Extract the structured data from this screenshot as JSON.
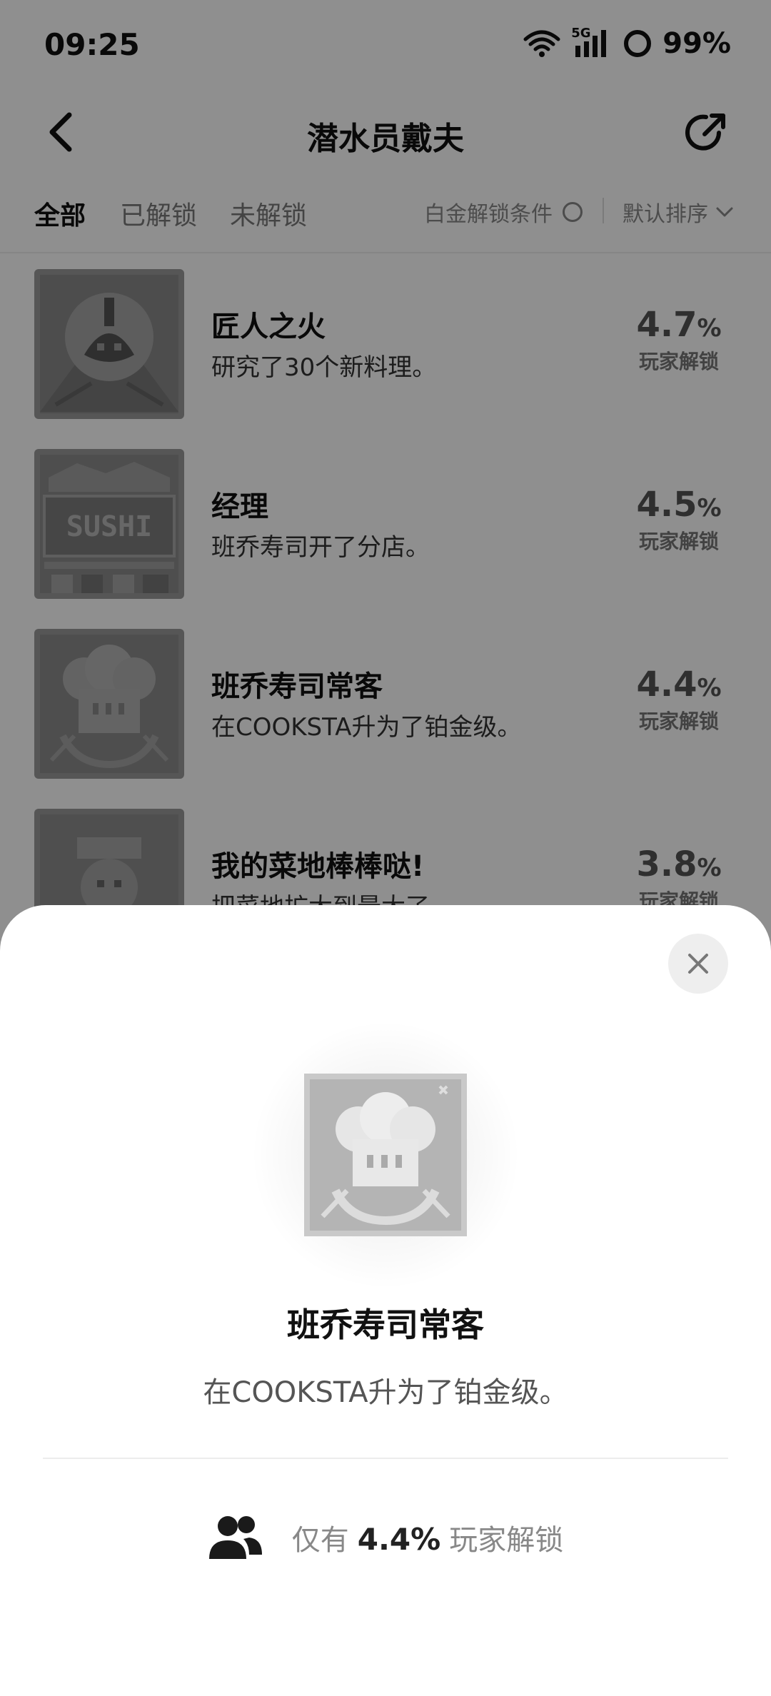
{
  "status_bar": {
    "time": "09:25",
    "network": "5G",
    "battery": "99%"
  },
  "nav": {
    "title": "潜水员戴夫"
  },
  "filters": {
    "tabs": [
      {
        "label": "全部",
        "active": true
      },
      {
        "label": "已解锁",
        "active": false
      },
      {
        "label": "未解锁",
        "active": false
      }
    ],
    "platinum_label": "白金解锁条件",
    "sort_label": "默认排序"
  },
  "achievements": [
    {
      "icon": "fire-flame-icon",
      "title": "匠人之火",
      "desc": "研究了30个新料理。",
      "pct": "4.7",
      "pct_sign": "%",
      "label": "玩家解锁"
    },
    {
      "icon": "sushi-shop-icon",
      "title": "经理",
      "desc": "班乔寿司开了分店。",
      "pct": "4.5",
      "pct_sign": "%",
      "label": "玩家解锁",
      "icon_text": "SUSHI"
    },
    {
      "icon": "chef-hat-icon",
      "title": "班乔寿司常客",
      "desc": "在COOKSTA升为了铂金级。",
      "pct": "4.4",
      "pct_sign": "%",
      "label": "玩家解锁"
    },
    {
      "icon": "farmer-icon",
      "title": "我的菜地棒棒哒!",
      "desc": "把菜地扩大到最大了。",
      "pct": "3.8",
      "pct_sign": "%",
      "label": "玩家解锁"
    }
  ],
  "sheet": {
    "icon": "chef-hat-icon",
    "title": "班乔寿司常客",
    "desc": "在COOKSTA升为了铂金级。",
    "stat_prefix": "仅有",
    "stat_pct": "4.4%",
    "stat_suffix": "玩家解锁"
  },
  "colors": {
    "overlay": "#000000",
    "sheet_bg": "#ffffff",
    "muted": "#888888"
  }
}
